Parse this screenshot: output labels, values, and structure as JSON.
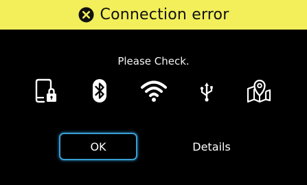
{
  "header": {
    "title": "Connection error",
    "icon": "error-x-circle-icon",
    "background_color": "#f2ef5a"
  },
  "message": "Please Check.",
  "icons": [
    "phone-lock-icon",
    "bluetooth-icon",
    "wifi-icon",
    "usb-icon",
    "map-pin-icon"
  ],
  "buttons": {
    "ok_label": "OK",
    "details_label": "Details",
    "focus_color": "#3a9fd6"
  }
}
